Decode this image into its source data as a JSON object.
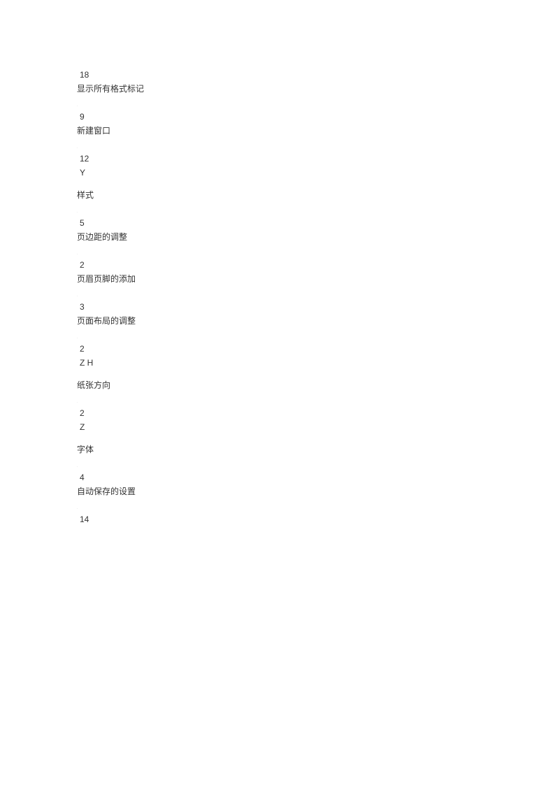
{
  "items": [
    {
      "num": "18",
      "code": "",
      "label": "显示所有格式标记"
    },
    {
      "num": "9",
      "code": "",
      "label": "新建窗口"
    },
    {
      "num": "12",
      "code": "Y",
      "label": "样式"
    },
    {
      "num": "5",
      "code": "",
      "label": "页边距的调整"
    },
    {
      "num": "2",
      "code": "",
      "label": "页眉页脚的添加"
    },
    {
      "num": "3",
      "code": "",
      "label": "页面布局的调整"
    },
    {
      "num": "2",
      "code": "Z H",
      "label": "纸张方向"
    },
    {
      "num": "2",
      "code": "Z",
      "label": "字体"
    },
    {
      "num": "4",
      "code": "",
      "label": "自动保存的设置"
    },
    {
      "num": "14",
      "code": "",
      "label": ""
    }
  ]
}
